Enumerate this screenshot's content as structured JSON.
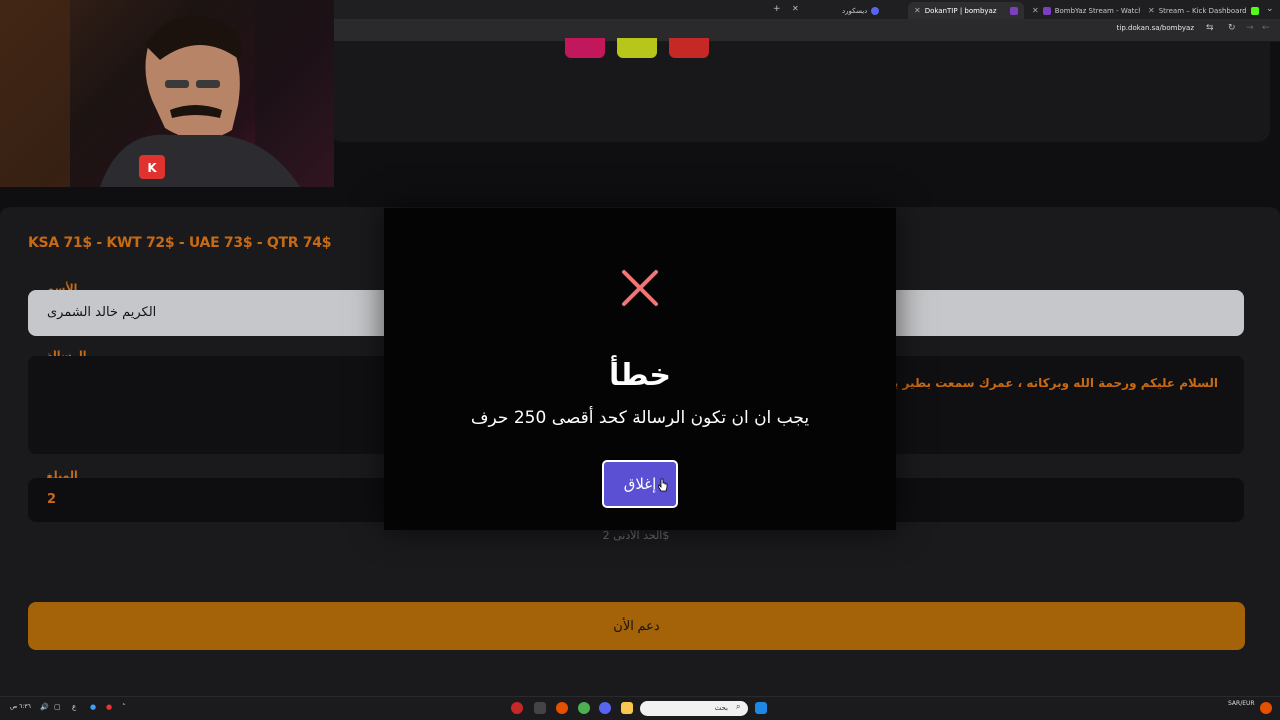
{
  "browser": {
    "tabs": [
      {
        "label": "ديسكورد",
        "color": "#5865f2"
      },
      {
        "label": "DokanTIP | bombyaz",
        "color": "#7b3fbf",
        "active": true
      },
      {
        "label": "BombYaz Stream - Watch L",
        "color": "#53fc18"
      },
      {
        "label": "Stream – Kick Dashboard",
        "color": "#53fc18"
      }
    ],
    "url": "tip.dokan.sa/bombyaz"
  },
  "form": {
    "prices": "KSA 71$ - KWT 72$ - UAE 73$ - QTR 74$",
    "name_label": "الأسم",
    "name_value": "الكريم خالد الشمرى",
    "message_label": "الرسالة",
    "message_value": "السلام عليكم ورحمة الله وبركاته ، عمرك سمعت بطير يحب ... تشتري بيت او سيارة او تتزوج كدعم من  اخوك الصيغير تقبل مروري",
    "amount_label": "المبلغ",
    "amount_value": "2",
    "min_note": "الحد الأدنى 2$",
    "submit_label": "دعم الأن"
  },
  "modal": {
    "title": "خطأ",
    "message": "يجب ان ان تكون الرسالة كحد أقصى 250 حرف",
    "close_label": "إغلاق",
    "icon": "close-x-icon",
    "icon_color": "#f27474"
  },
  "taskbar": {
    "search_placeholder": "بحث",
    "tray_locale": "SAR/EUR",
    "tray_clock": "٦:٣٦ ص"
  },
  "colors": {
    "accent": "#c86a14",
    "button_primary": "#5b4fd3",
    "button_support": "#a46209"
  }
}
